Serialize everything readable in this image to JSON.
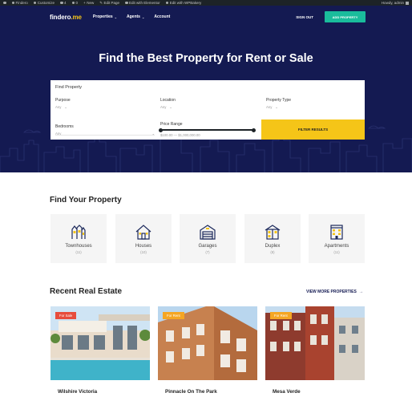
{
  "admin_bar": {
    "items": [
      {
        "icon": "wordpress-icon",
        "label": ""
      },
      {
        "icon": "home-icon",
        "label": "Findero"
      },
      {
        "icon": "brush-icon",
        "label": "Customize"
      },
      {
        "icon": "refresh-icon",
        "label": "4"
      },
      {
        "icon": "comment-icon",
        "label": "0"
      },
      {
        "icon": "plus-icon",
        "label": "New"
      },
      {
        "icon": "pencil-icon",
        "label": "Edit Page"
      },
      {
        "icon": "elementor-icon",
        "label": "Edit with Elementor"
      },
      {
        "icon": "wpbakery-icon",
        "label": "Edit with WPBakery"
      }
    ],
    "user": "Howdy, admin"
  },
  "nav": {
    "logo_main": "findero",
    "logo_suffix": ".me",
    "menu": [
      {
        "label": "Properties",
        "has_dropdown": true
      },
      {
        "label": "Agents",
        "has_dropdown": true
      },
      {
        "label": "Account",
        "has_dropdown": false
      }
    ],
    "sign_out": "SIGN OUT",
    "add_property": "ADD PROPERTY"
  },
  "hero": {
    "title": "Find the Best Property for Rent or Sale"
  },
  "search": {
    "title": "Find Property",
    "purpose_label": "Purpose",
    "purpose_value": "Any",
    "location_label": "Location",
    "location_value": "Any",
    "type_label": "Property Type",
    "type_value": "Any",
    "bedrooms_label": "Bedrooms",
    "bedrooms_value": "Any",
    "price_label": "Price Range",
    "price_value": "$100.00 — $1,000,000.00",
    "filter_label": "FILTER RESULTS"
  },
  "find_section": {
    "title": "Find Your Property",
    "types": [
      {
        "name": "Townhouses",
        "count": "(11)",
        "icon": "townhouse-icon"
      },
      {
        "name": "Houses",
        "count": "(10)",
        "icon": "house-icon"
      },
      {
        "name": "Garages",
        "count": "(7)",
        "icon": "garage-icon"
      },
      {
        "name": "Duplex",
        "count": "(8)",
        "icon": "duplex-icon"
      },
      {
        "name": "Apartments",
        "count": "(11)",
        "icon": "apartment-icon"
      }
    ]
  },
  "recent_section": {
    "title": "Recent Real Estate",
    "view_more": "VIEW MORE PROPERTIES",
    "listings": [
      {
        "badge": "For Sale",
        "badge_color": "#e74c3c",
        "name": "Wilshire Victoria"
      },
      {
        "badge": "For Rent",
        "badge_color": "#f5a623",
        "name": "Pinnacle On The Park"
      },
      {
        "badge": "For Rent",
        "badge_color": "#f5a623",
        "name": "Mesa Verde"
      }
    ]
  },
  "colors": {
    "hero_bg": "#141a52",
    "accent_yellow": "#f5c518",
    "accent_green": "#1abc9c"
  }
}
